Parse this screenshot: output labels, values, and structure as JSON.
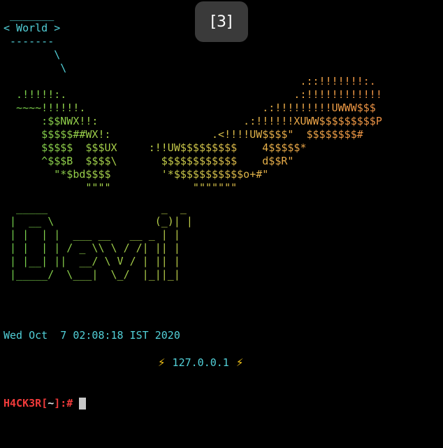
{
  "overlay": {
    "badge": "[3]"
  },
  "terminal": {
    "cowsay": " _______\n< World >\n -------\n        \\\n         \\",
    "art": "                                               .::!!!!!!!:.\n  .!!!!!:.                                    .:!!!!!!!!!!!!\n  ~~~~!!!!!!.                            .:!!!!!!!!!UWWW$$$\n      :$$NWX!!:                       .:!!!!!!XUWW$$$$$$$$$P\n      $$$$$##WX!:                .<!!!!UW$$$$\"  $$$$$$$$#\n      $$$$$  $$$UX     :!!UW$$$$$$$$$    4$$$$$*\n      ^$$$B  $$$$\\       $$$$$$$$$$$$    d$$R\"\n        \"*$bd$$$$        '*$$$$$$$$$$$o+#\"\n             \"\"\"\"             \"\"\"\"\"\"\"",
    "logo": "  _____                  _  _\n |  __ \\                (_)| |\n | |  | |  ___ __   __ _ | |\n | |  | | / _ \\\\ \\ / /| || |\n | |__| ||  __/ \\ V / | || |\n |_____/  \\___|  \\_/  |_||_|",
    "date": "Wed Oct  7 02:08:18 IST 2020",
    "ip": "127.0.0.1",
    "prompt": {
      "host": "H4CK3R",
      "open": "[",
      "dir": "~",
      "close": "]",
      "suffix": ":#"
    }
  },
  "colors": {
    "background": "#000000",
    "cyan": "#52d0d8",
    "prompt_red": "#ef3a3a",
    "bolt": "#f5c518"
  },
  "icons": {
    "bolt": "lightning-bolt-icon",
    "bolt_glyph": "⚡"
  }
}
